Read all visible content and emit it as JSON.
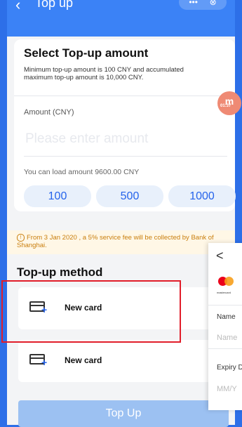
{
  "header": {
    "back_icon": "‹",
    "title": "Top up",
    "icons": [
      "more-icon",
      "close-icon"
    ],
    "more": "•••",
    "close": "⊗"
  },
  "amount_section": {
    "title": "Select Top-up amount",
    "subtitle": "Minimum top-up amount is 100 CNY and accumulated maximum top-up amount is 10,000 CNY.",
    "amount_label": "Amount (CNY)",
    "amount_placeholder": "Please enter amount",
    "load_text": "You can load amount 9600.00 CNY",
    "quick_amounts": [
      "100",
      "500",
      "1000"
    ]
  },
  "floating_badge": {
    "main": "m",
    "time": "01:37"
  },
  "notice": {
    "text": "From 3 Jan 2020 , a 5% service fee will be collected by Bank of Shanghai."
  },
  "method_section": {
    "title": "Top-up method",
    "items": [
      {
        "label": "New card"
      },
      {
        "label": "New card"
      }
    ]
  },
  "topup_button": {
    "label": "Top Up"
  },
  "side_panel": {
    "back": "<",
    "brand": "mastercard",
    "name_label": "Name",
    "name_placeholder": "Name",
    "expiry_label": "Expiry D",
    "expiry_placeholder": "MM/Y"
  },
  "colors": {
    "primary": "#3b82f6",
    "accent": "#2563eb",
    "notice": "#c97e0d",
    "highlight": "#e11d2a"
  }
}
